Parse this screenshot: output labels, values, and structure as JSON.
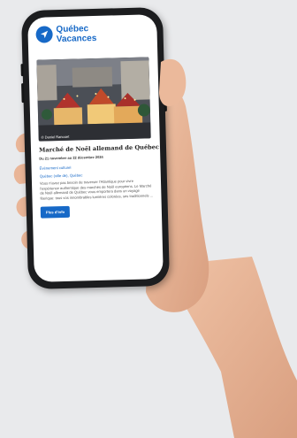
{
  "app": {
    "logo_line1": "Québec",
    "logo_line2": "Vacances"
  },
  "event": {
    "photo_credit": "© Daniel Ranouet",
    "title": "Marché de Noël allemand de Québec",
    "dates": "Du 21 novembre au 22 décembre 2024",
    "category": "Événement culturel",
    "location": "Québec (ville de), Québec",
    "description": "Vous n'avez pas besoin de traverser l'Atlantique pour vivre l'expérience authentique des marchés de Noël européens. Le Marché de Noël allemand de Québec vous emportera dans un voyage féerique: tous vos innombrables lumières colorées, ses traditionnels ...",
    "more_label": "Plus d'info"
  },
  "colors": {
    "brand": "#1769c7",
    "phone_body": "#1c1d1f",
    "background": "#e9eaec",
    "skin": "#e8b597"
  },
  "icons": {
    "logo": "paper-plane-icon"
  }
}
